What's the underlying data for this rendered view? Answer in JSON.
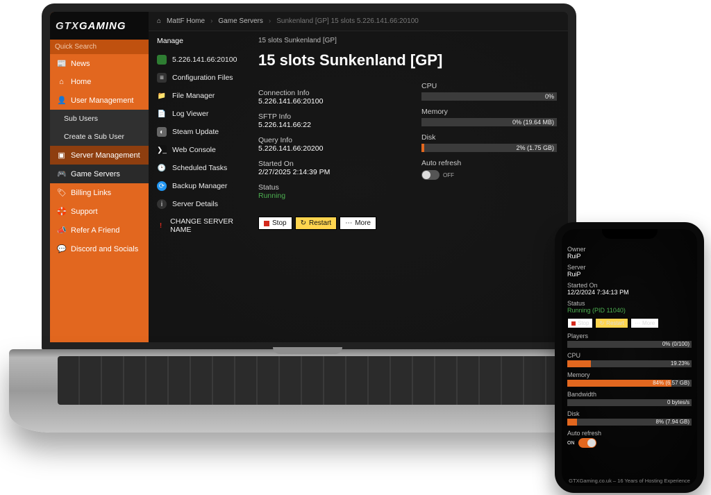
{
  "logo": {
    "gtx": "GTX",
    "gaming": "GAMING"
  },
  "search": {
    "placeholder": "Quick Search"
  },
  "nav": {
    "news": "News",
    "home": "Home",
    "user_mgmt": "User Management",
    "sub_users": "Sub Users",
    "create_sub": "Create a Sub User",
    "server_mgmt": "Server Management",
    "game_servers": "Game Servers",
    "billing": "Billing Links",
    "support": "Support",
    "refer": "Refer A Friend",
    "discord": "Discord and Socials"
  },
  "crumbs": {
    "home": "MattF Home",
    "servers": "Game Servers",
    "current": "Sunkenland [GP] 15 slots 5.226.141.66:20100"
  },
  "manage": {
    "heading": "Manage",
    "ip": "5.226.141.66:20100",
    "config": "Configuration Files",
    "file_mgr": "File Manager",
    "log": "Log Viewer",
    "steam": "Steam Update",
    "console": "Web Console",
    "sched": "Scheduled Tasks",
    "backup": "Backup Manager",
    "details": "Server Details",
    "change_name": "CHANGE SERVER NAME"
  },
  "server": {
    "toprow": "15 slots Sunkenland [GP]",
    "title": "15 slots Sunkenland [GP]",
    "conn_lbl": "Connection Info",
    "conn_val": "5.226.141.66:20100",
    "sftp_lbl": "SFTP Info",
    "sftp_val": "5.226.141.66:22",
    "query_lbl": "Query Info",
    "query_val": "5.226.141.66:20200",
    "started_lbl": "Started On",
    "started_val": "2/27/2025 2:14:39 PM",
    "status_lbl": "Status",
    "status_val": "Running",
    "cpu_lbl": "CPU",
    "cpu_pct": 0,
    "cpu_txt": "0%",
    "mem_lbl": "Memory",
    "mem_pct": 0,
    "mem_txt": "0% (19.64 MB)",
    "disk_lbl": "Disk",
    "disk_pct": 2,
    "disk_txt": "2% (1.75 GB)",
    "auto_lbl": "Auto refresh",
    "auto_state": "OFF",
    "btn_stop": "Stop",
    "btn_restart": "Restart",
    "btn_more": "More"
  },
  "phone": {
    "owner_lbl": "Owner",
    "owner_val": "RuiP",
    "server_lbl": "Server",
    "server_val": "RuiP",
    "started_lbl": "Started On",
    "started_val": "12/2/2024 7:34:13 PM",
    "status_lbl": "Status",
    "status_val": "Running (PID 11040)",
    "btn_stop": "Stop",
    "btn_restart": "Restart",
    "btn_more": "More",
    "players_lbl": "Players",
    "players_txt": "0% (0/100)",
    "players_pct": 0,
    "cpu_lbl": "CPU",
    "cpu_txt": "19.23%",
    "cpu_pct": 19.23,
    "mem_lbl": "Memory",
    "mem_txt": "84% (6.57 GB)",
    "mem_pct": 84,
    "bw_lbl": "Bandwidth",
    "bw_txt": "0 bytes/s",
    "bw_pct": 0,
    "disk_lbl": "Disk",
    "disk_txt": "8% (7.94 GB)",
    "disk_pct": 8,
    "auto_lbl": "Auto refresh",
    "auto_state": "ON",
    "footer": "GTXGaming.co.uk – 16 Years of Hosting Experience"
  }
}
